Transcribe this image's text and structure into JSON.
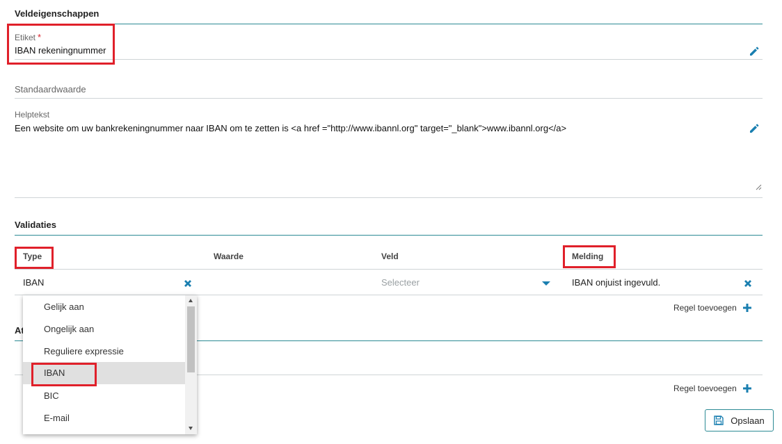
{
  "properties": {
    "title": "Veldeigenschappen",
    "label_field": {
      "label": "Etiket",
      "required_mark": "*",
      "value": "IBAN rekeningnummer"
    },
    "default_field": {
      "label": "Standaardwaarde"
    },
    "help_field": {
      "label": "Helptekst",
      "value": "Een website om uw bankrekeningnummer naar IBAN om te zetten is <a  href =\"http://www.ibannl.org\" target=\"_blank\">www.ibannl.org</a>"
    }
  },
  "validations": {
    "title": "Validaties",
    "columns": [
      "Type",
      "Waarde",
      "Veld",
      "Melding"
    ],
    "row": {
      "type": "IBAN",
      "field_placeholder": "Selecteer",
      "message": "IBAN onjuist ingevuld."
    },
    "add_rule_label": "Regel toevoegen"
  },
  "hidden_section": {
    "title_partial": "At",
    "add_rule_label": "Regel toevoegen"
  },
  "dropdown": {
    "options": [
      "Gelijk aan",
      "Ongelijk aan",
      "Reguliere expressie",
      "IBAN",
      "BIC",
      "E-mail"
    ],
    "selected": "IBAN"
  },
  "save_label": "Opslaan",
  "colors": {
    "accent": "#2b8a94",
    "icon_blue": "#1a7fb0",
    "highlight": "#e0202a",
    "required": "#d9232d"
  }
}
